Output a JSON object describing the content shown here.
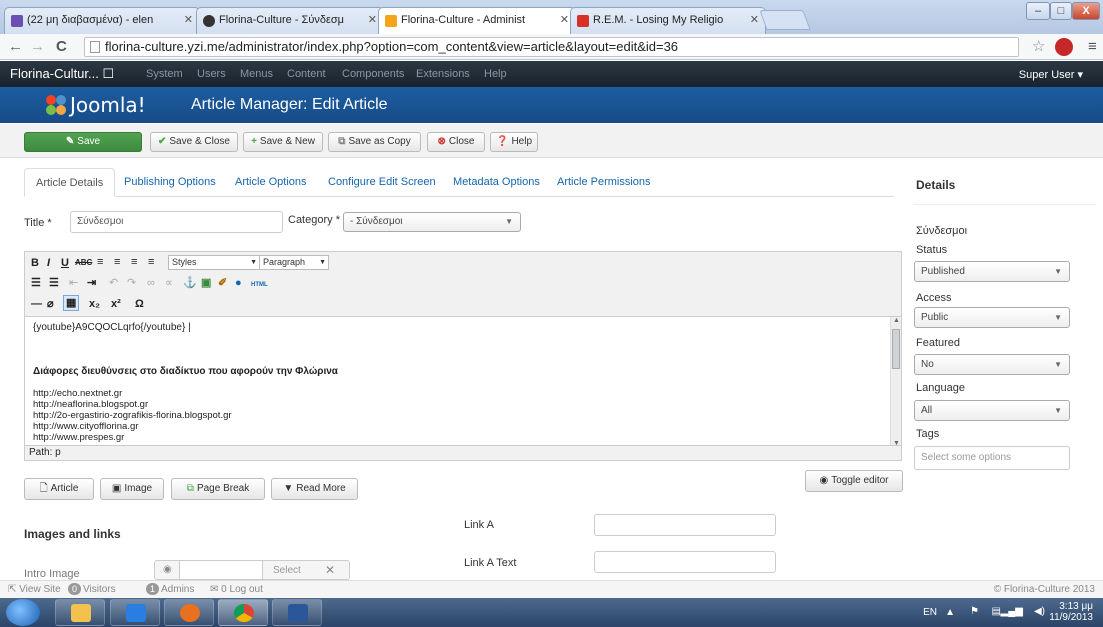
{
  "browser": {
    "tabs": [
      {
        "label": "(22 μη διαβασμένα) - elen",
        "favicon_color": "#6c4fb3"
      },
      {
        "label": "Florina-Culture - Σύνδεσμ",
        "favicon_color": "#333333"
      },
      {
        "label": "Florina-Culture - Administ",
        "favicon_color": "#f4a419"
      },
      {
        "label": "R.E.M. - Losing My Religio",
        "favicon_color": "#d93025"
      }
    ],
    "url": "florina-culture.yzi.me/administrator/index.php?option=com_content&view=article&layout=edit&id=36",
    "win_min": "–",
    "win_max": "□",
    "win_close": "X"
  },
  "jnav": {
    "brand": "Florina-Cultur... ☐",
    "menus": [
      "System",
      "Users",
      "Menus",
      "Content",
      "Components",
      "Extensions",
      "Help"
    ],
    "user": "Super User ▾"
  },
  "header": {
    "logo": "Joomla!",
    "title": "Article Manager: Edit Article"
  },
  "toolbar": {
    "save": "Save",
    "save_close": "Save & Close",
    "save_new": "Save & New",
    "save_copy": "Save as Copy",
    "close": "Close",
    "help": "Help"
  },
  "tabs": [
    "Article Details",
    "Publishing Options",
    "Article Options",
    "Configure Edit Screen",
    "Metadata Options",
    "Article Permissions"
  ],
  "form": {
    "title_label": "Title *",
    "title_value": "Σύνδεσμοι",
    "category_label": "Category *",
    "category_value": "- Σύνδεσμοι"
  },
  "editor": {
    "styles": "Styles",
    "paragraph": "Paragraph",
    "lines": [
      "{youtube}A9CQOCLqrfo{/youtube}  |",
      "Διάφορες διευθύνσεις στο διαδίκτυο που αφορούν την Φλώρινα",
      "http://echo.nextnet.gr",
      "http://neaflorina.blogspot.gr",
      "http://2o-ergastirio-zografikis-florina.blogspot.gr",
      "http://www.cityofflorina.gr",
      "http://www.prespes.gr"
    ],
    "path": "Path: p",
    "toggle": "Toggle editor"
  },
  "editor_buttons": {
    "article": "Article",
    "image": "Image",
    "page_break": "Page Break",
    "read_more": "Read More"
  },
  "images_links": {
    "heading": "Images and links",
    "intro_image": "Intro Image",
    "select": "Select",
    "link_a": "Link A",
    "link_a_text": "Link A Text"
  },
  "sidebar": {
    "heading": "Details",
    "category": "Σύνδεσμοι",
    "status_label": "Status",
    "status_value": "Published",
    "access_label": "Access",
    "access_value": "Public",
    "featured_label": "Featured",
    "featured_value": "No",
    "language_label": "Language",
    "language_value": "All",
    "tags_label": "Tags",
    "tags_placeholder": "Select some options"
  },
  "statusbar": {
    "view_site": "View Site",
    "visitors_count": "0",
    "visitors": "Visitors",
    "admins_count": "1",
    "admins": "Admins",
    "logout": "0 Log out",
    "copyright": "© Florina-Culture 2013"
  },
  "taskbar": {
    "lang": "EN",
    "time": "3:13 μμ",
    "date": "11/9/2013"
  },
  "colors": {
    "save_green": "#46a546",
    "joomla_blue": "#1a5798",
    "nav_dark": "#1f2a35",
    "link_blue": "#1565b0"
  }
}
